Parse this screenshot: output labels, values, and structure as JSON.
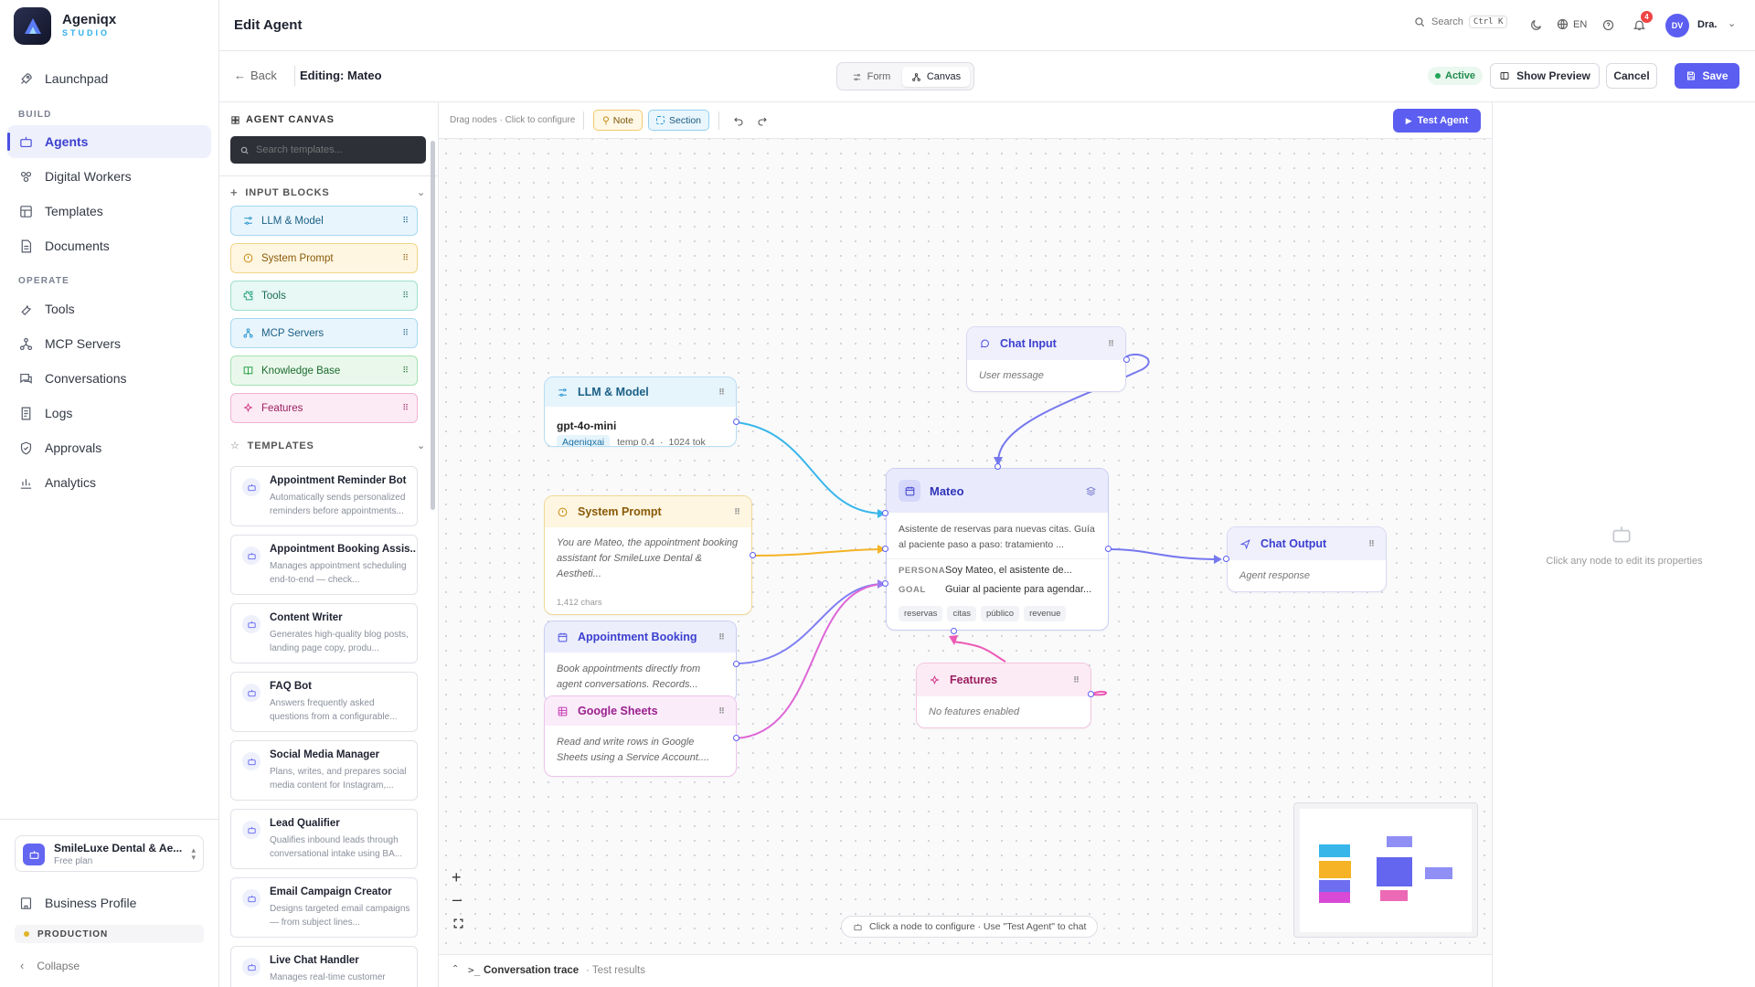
{
  "brand": {
    "name": "Ageniqx",
    "sub": "STUDIO"
  },
  "sidebar": {
    "launchpad": "Launchpad",
    "build_label": "BUILD",
    "build_items": [
      "Agents",
      "Digital Workers",
      "Templates",
      "Documents"
    ],
    "operate_label": "OPERATE",
    "operate_items": [
      "Tools",
      "MCP Servers",
      "Conversations",
      "Logs",
      "Approvals",
      "Analytics"
    ],
    "workspace": {
      "name": "SmileLuxe Dental & Ae...",
      "plan": "Free plan"
    },
    "business_profile": "Business Profile",
    "env": "PRODUCTION",
    "collapse": "Collapse"
  },
  "topbar": {
    "title": "Edit Agent",
    "search": "Search",
    "shortcut": "Ctrl K",
    "lang": "EN",
    "notifications": "4",
    "avatar": "DV",
    "user": "Dra."
  },
  "subbar": {
    "back": "Back",
    "editing": "Editing: Mateo",
    "view_form": "Form",
    "view_canvas": "Canvas",
    "status": "Active",
    "show_preview": "Show Preview",
    "cancel": "Cancel",
    "save": "Save"
  },
  "palette": {
    "title": "AGENT CANVAS",
    "search_placeholder": "Search templates...",
    "input_blocks_label": "INPUT BLOCKS",
    "blocks": [
      "LLM & Model",
      "System Prompt",
      "Tools",
      "MCP Servers",
      "Knowledge Base",
      "Features"
    ],
    "templates_label": "TEMPLATES",
    "templates": [
      {
        "title": "Appointment Reminder Bot",
        "desc": "Automatically sends personalized reminders before appointments..."
      },
      {
        "title": "Appointment Booking Assis...",
        "desc": "Manages appointment scheduling end-to-end — check..."
      },
      {
        "title": "Content Writer",
        "desc": "Generates high-quality blog posts, landing page copy, produ..."
      },
      {
        "title": "FAQ Bot",
        "desc": "Answers frequently asked questions from a configurable..."
      },
      {
        "title": "Social Media Manager",
        "desc": "Plans, writes, and prepares social media content for Instagram,..."
      },
      {
        "title": "Lead Qualifier",
        "desc": "Qualifies inbound leads through conversational intake using BA..."
      },
      {
        "title": "Email Campaign Creator",
        "desc": "Designs targeted email campaigns — from subject lines..."
      },
      {
        "title": "Live Chat Handler",
        "desc": "Manages real-time customer"
      }
    ]
  },
  "canvas_toolbar": {
    "hint": "Drag nodes · Click to configure",
    "note": "Note",
    "section": "Section",
    "test_agent": "Test Agent"
  },
  "nodes": {
    "llm": {
      "title": "LLM & Model",
      "model": "gpt-4o-mini",
      "provider": "Ageniqxai",
      "temp": "temp 0.4",
      "tokens": "1024 tok"
    },
    "system_prompt": {
      "title": "System Prompt",
      "text": "You are Mateo, the appointment booking assistant for SmileLuxe Dental & Aestheti...",
      "chars": "1,412 chars"
    },
    "appointment": {
      "title": "Appointment Booking",
      "text": "Book appointments directly from agent conversations. Records..."
    },
    "sheets": {
      "title": "Google Sheets",
      "text": "Read and write rows in Google Sheets using a Service Account...."
    },
    "chat_input": {
      "title": "Chat Input",
      "text": "User message"
    },
    "mateo": {
      "title": "Mateo",
      "desc": "Asistente de reservas para nuevas citas. Guía al paciente paso a paso: tratamiento ...",
      "persona_label": "PERSONA",
      "persona": "Soy Mateo, el asistente de...",
      "goal_label": "GOAL",
      "goal": "Guiar al paciente para agendar...",
      "tags": [
        "reservas",
        "citas",
        "público",
        "revenue"
      ]
    },
    "features": {
      "title": "Features",
      "text": "No features enabled"
    },
    "chat_output": {
      "title": "Chat Output",
      "text": "Agent response"
    }
  },
  "canvas": {
    "hint_pill": "Click a node to configure · Use \"Test Agent\" to chat"
  },
  "right_panel": {
    "hint": "Click any node to edit its properties"
  },
  "trace": {
    "label": "Conversation trace",
    "sub": "· Test results"
  },
  "colors": {
    "accent": "#5b5ef0",
    "active_green": "#22a55a"
  }
}
